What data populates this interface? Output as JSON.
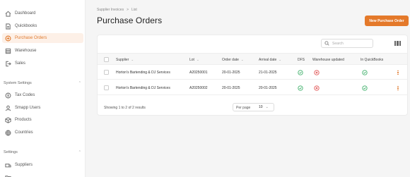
{
  "sidebar": {
    "items": [
      {
        "label": "Dashboard",
        "icon": "home-icon",
        "active": false
      },
      {
        "label": "Quickbooks",
        "icon": "document-icon",
        "active": false
      },
      {
        "label": "Purchase Orders",
        "icon": "cart-icon",
        "active": true
      },
      {
        "label": "Warehouse",
        "icon": "warehouse-icon",
        "active": false
      },
      {
        "label": "Sales",
        "icon": "logout-icon",
        "active": false
      }
    ],
    "system_settings": {
      "title": "System Settings",
      "items": [
        {
          "label": "Tax Codes",
          "icon": "tax-icon"
        },
        {
          "label": "Smapp Users",
          "icon": "user-icon"
        },
        {
          "label": "Products",
          "icon": "box-icon"
        },
        {
          "label": "Countries",
          "icon": "globe-icon"
        }
      ]
    },
    "settings": {
      "title": "Settings",
      "items": [
        {
          "label": "Suppliers",
          "icon": "truck-icon"
        }
      ]
    }
  },
  "breadcrumb": {
    "parent": "Supplier Invoices",
    "separator": ">",
    "current": "List"
  },
  "page": {
    "title": "Purchase Orders",
    "new_button": "New Purchase Order"
  },
  "search": {
    "placeholder": "Search",
    "value": ""
  },
  "table": {
    "columns": [
      "Supplier",
      "Lot",
      "Order date",
      "Arrival date",
      "DFS",
      "Warehouse updated",
      "In QuickBooks"
    ],
    "rows": [
      {
        "supplier": "Horton's Bartending & DJ Services",
        "lot": "A20250001",
        "order_date": "20-01-2025",
        "arrival_date": "21-01-2025",
        "dfs": true,
        "warehouse_updated": false,
        "in_quickbooks": true
      },
      {
        "supplier": "Horton's Bartending & DJ Services",
        "lot": "A20250002",
        "order_date": "20-01-2025",
        "arrival_date": "20-01-2025",
        "dfs": true,
        "warehouse_updated": false,
        "in_quickbooks": true
      }
    ]
  },
  "footer": {
    "summary": "Showing 1 to 2 of 2 results",
    "per_page_label": "Per page",
    "per_page_value": "10"
  },
  "colors": {
    "accent": "#e4792a",
    "success": "#3fb06a",
    "error": "#e15656"
  }
}
